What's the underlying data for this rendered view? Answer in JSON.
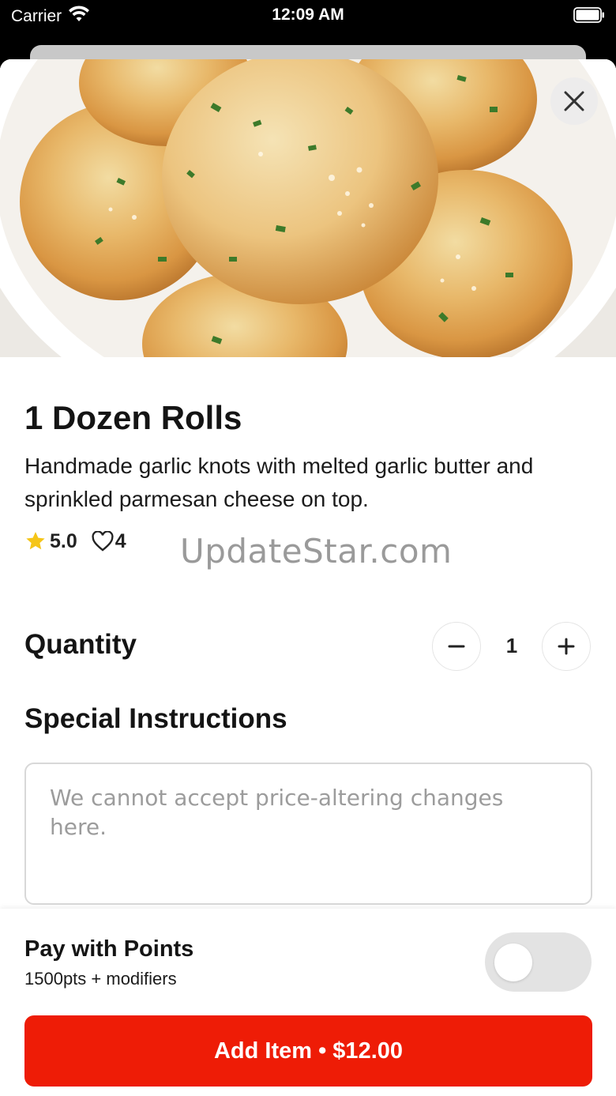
{
  "status_bar": {
    "carrier": "Carrier",
    "time": "12:09 AM",
    "icons": [
      "wifi-icon",
      "battery-icon"
    ]
  },
  "product": {
    "title": "1 Dozen Rolls",
    "description": "Handmade garlic knots with melted garlic butter and sprinkled parmesan cheese on top.",
    "rating": "5.0",
    "likes": "4",
    "image": "garlic-knots-photo"
  },
  "watermark": "UpdateStar.com",
  "quantity": {
    "label": "Quantity",
    "value": "1"
  },
  "instructions": {
    "label": "Special Instructions",
    "placeholder": "We cannot accept price-altering changes here."
  },
  "points": {
    "title": "Pay with Points",
    "subtitle": "1500pts + modifiers",
    "enabled": false
  },
  "add_button": {
    "label": "Add Item • $12.00"
  },
  "colors": {
    "accent": "#EE1C06",
    "star": "#F5C518",
    "toggle_off": "#E3E3E3"
  }
}
